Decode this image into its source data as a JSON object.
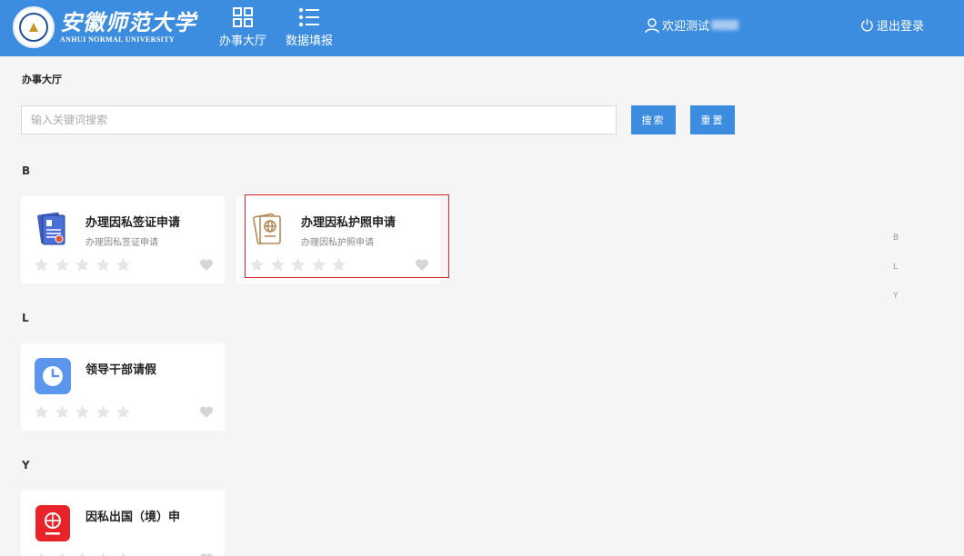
{
  "header": {
    "logo_cn": "安徽师范大学",
    "logo_en": "ANHUI NORMAL UNIVERSITY",
    "nav": [
      {
        "label": "办事大厅",
        "icon": "grid-icon"
      },
      {
        "label": "数据填报",
        "icon": "list-icon"
      }
    ],
    "user_greeting": "欢迎测试",
    "logout_label": "退出登录",
    "brand_color": "#3c8de0"
  },
  "breadcrumb": "办事大厅",
  "search": {
    "placeholder": "输入关键词搜索",
    "value": "",
    "search_label": "搜索",
    "reset_label": "重置"
  },
  "sections": [
    {
      "letter": "B",
      "items": [
        {
          "title": "办理因私签证申请",
          "subtitle": "办理因私签证申请",
          "icon": "visa-document-icon",
          "rating": 0,
          "favorited": false
        },
        {
          "title": "办理因私护照申请",
          "subtitle": "办理因私护照申请",
          "icon": "passport-icon",
          "rating": 0,
          "favorited": false,
          "selected": true
        }
      ]
    },
    {
      "letter": "L",
      "items": [
        {
          "title": "领导干部请假",
          "subtitle": "",
          "icon": "clock-icon",
          "rating": 0,
          "favorited": false
        }
      ]
    },
    {
      "letter": "Y",
      "items": [
        {
          "title": "因私出国（境）申",
          "subtitle": "",
          "icon": "globe-passport-icon",
          "rating": 0,
          "favorited": false
        }
      ]
    }
  ],
  "index": [
    "B",
    "L",
    "Y"
  ]
}
